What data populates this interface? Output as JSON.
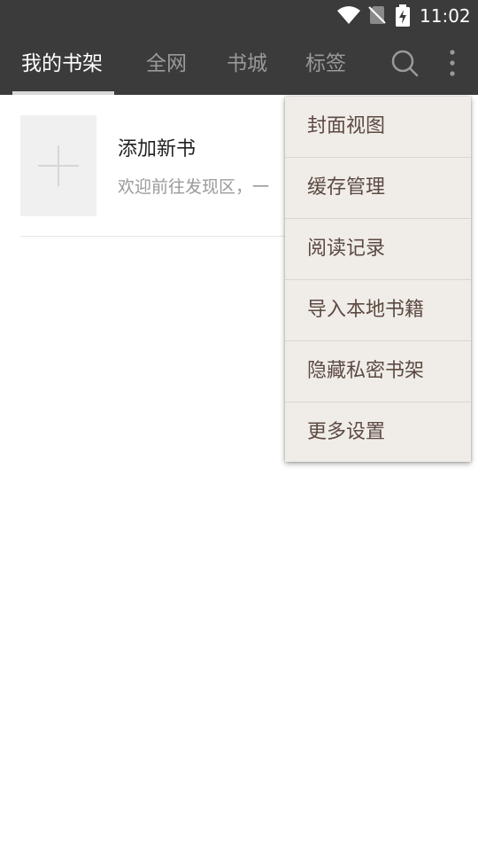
{
  "status_bar": {
    "time": "11:02",
    "icons": [
      "wifi-icon",
      "no-sim-icon",
      "battery-charging-icon"
    ]
  },
  "app_bar": {
    "tabs": [
      {
        "label": "我的书架",
        "active": true
      },
      {
        "label": "全网",
        "active": false
      },
      {
        "label": "书城",
        "active": false
      },
      {
        "label": "标签",
        "active": false
      }
    ],
    "actions": [
      "search-icon",
      "more-vert-icon"
    ]
  },
  "bookshelf": {
    "add_book": {
      "title": "添加新书",
      "description": "欢迎前往发现区，一"
    }
  },
  "menu": {
    "items": [
      {
        "label": "封面视图"
      },
      {
        "label": "缓存管理"
      },
      {
        "label": "阅读记录"
      },
      {
        "label": "导入本地书籍"
      },
      {
        "label": "隐藏私密书架"
      },
      {
        "label": "更多设置"
      }
    ]
  },
  "colors": {
    "app_bar_bg": "#3b3b3b",
    "tab_active": "#ffffff",
    "tab_inactive": "#9a9a9a",
    "menu_bg": "#f0ede8",
    "menu_text": "#5d4a42"
  }
}
